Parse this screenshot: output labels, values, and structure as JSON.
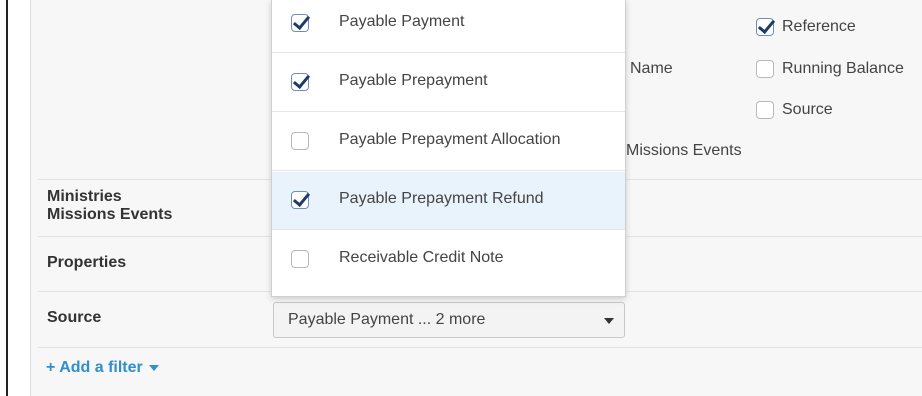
{
  "columns": {
    "name_partial": "Name",
    "missions_partial": "Missions Events",
    "options": [
      {
        "label": "Reference",
        "checked": true
      },
      {
        "label": "Running Balance",
        "checked": false
      },
      {
        "label": "Source",
        "checked": false
      }
    ]
  },
  "filters": {
    "rows": [
      {
        "label_line1": "Ministries",
        "label_line2": "Missions Events"
      },
      {
        "label": "Properties"
      },
      {
        "label": "Source"
      }
    ],
    "source_select_value": "Payable Payment ... 2 more",
    "add_filter_label": "+ Add a filter"
  },
  "dropdown": {
    "items": [
      {
        "label": "Payable Payment",
        "checked": true
      },
      {
        "label": "Payable Prepayment",
        "checked": true
      },
      {
        "label": "Payable Prepayment Allocation",
        "checked": false
      },
      {
        "label": "Payable Prepayment Refund",
        "checked": true
      },
      {
        "label": "Receivable Credit Note",
        "checked": false
      }
    ],
    "highlighted_index": 3
  },
  "colors": {
    "link": "#2f8fd0",
    "highlight": "#e9f3fb",
    "check": "#1f3a67"
  }
}
